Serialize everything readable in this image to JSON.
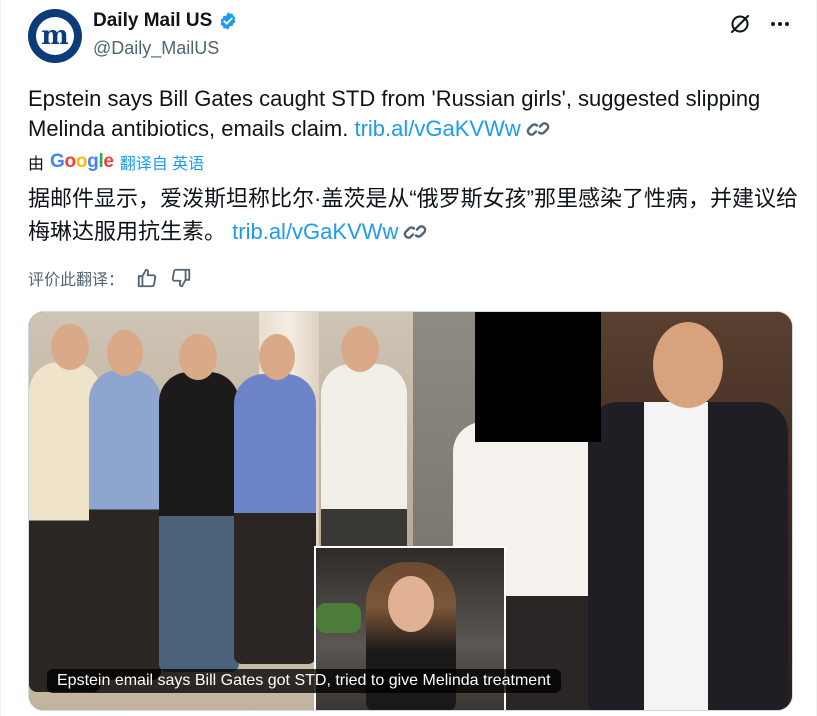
{
  "account": {
    "display_name": "Daily Mail US",
    "handle": "@Daily_MailUS",
    "avatar_letter": "m"
  },
  "tweet": {
    "text_part1": "Epstein says Bill Gates caught STD from 'Russian girls', suggested slipping Melinda antibiotics, emails claim.",
    "link": "trib.al/vGaKVWw"
  },
  "translation": {
    "by_label": "由",
    "google": {
      "G": "G",
      "o1": "o",
      "o2": "o",
      "g": "g",
      "l": "l",
      "e": "e"
    },
    "from_label": "翻译自 英语",
    "text": "据邮件显示，爱泼斯坦称比尔·盖茨是从“俄罗斯女孩”那里感染了性病，并建议给梅琳达服用抗生素。",
    "link": "trib.al/vGaKVWw"
  },
  "rate": {
    "label": "评价此翻译："
  },
  "media": {
    "caption": "Epstein email says Bill Gates got STD, tried to give Melinda treatment"
  },
  "colors": {
    "link": "#1d9bf0",
    "verified": "#1d9bf0",
    "avatar": "#0d3a78",
    "secondary_text": "#536471"
  },
  "icons": {
    "verified": "verified-badge-icon",
    "grok": "grok-icon",
    "more": "more-icon",
    "link": "link-icon",
    "thumbs_up": "thumbs-up-icon",
    "thumbs_down": "thumbs-down-icon"
  }
}
